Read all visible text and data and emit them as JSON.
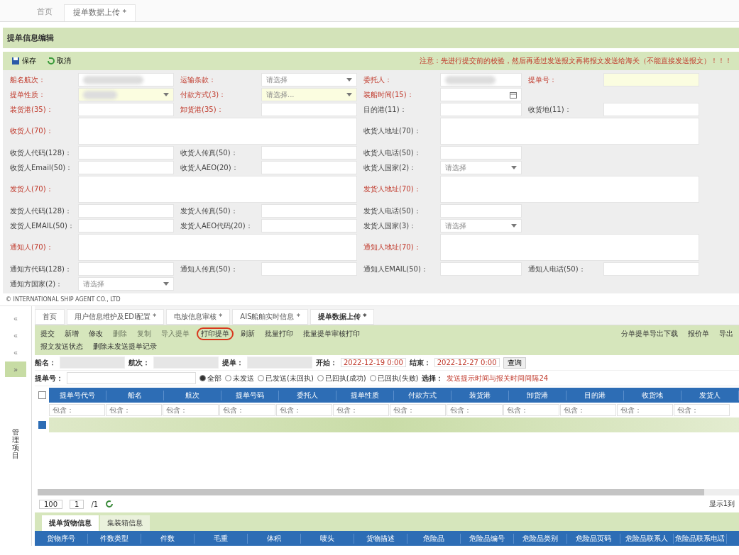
{
  "top_tabs": [
    {
      "label": "首页",
      "selected": false
    },
    {
      "label": "提单数据上传 *",
      "selected": true
    }
  ],
  "panel_title": "提单信息编辑",
  "toolbar": [
    {
      "label": "保存",
      "kind": "save"
    },
    {
      "label": "取消",
      "kind": "cancel"
    }
  ],
  "notice": "注意：先进行提交前的校验，然后再通过发送报文再将报文发送给海关（不能直接发送报文）！！！",
  "form_rows": [
    [
      {
        "label": "船名航次：",
        "required": true,
        "kind": "masked"
      },
      {
        "label": "运输条款：",
        "required": true,
        "kind": "select",
        "value": "请选择"
      },
      {
        "label": "委托人：",
        "required": true,
        "kind": "masked"
      },
      {
        "label": "提单号：",
        "required": true,
        "kind": "text",
        "highlighted": true
      }
    ],
    [
      {
        "label": "提单性质：",
        "required": true,
        "kind": "masked-select",
        "highlighted": true
      },
      {
        "label": "付款方式(3)：",
        "required": true,
        "kind": "select",
        "value": "请选择...",
        "highlighted": true
      },
      {
        "label": "装船时间(15)：",
        "required": true,
        "kind": "date"
      }
    ],
    [
      {
        "label": "装货港(35)：",
        "required": true,
        "kind": "text"
      },
      {
        "label": "卸货港(35)：",
        "required": true,
        "kind": "text"
      },
      {
        "label": "目的港(11)：",
        "required": false,
        "kind": "text"
      },
      {
        "label": "收货地(11)：",
        "required": false,
        "kind": "text"
      }
    ],
    [
      {
        "label": "收货人(70)：",
        "required": true,
        "kind": "area"
      },
      {
        "label": "收货人地址(70)：",
        "required": false,
        "kind": "area"
      }
    ],
    [
      {
        "label": "收货人代码(128)：",
        "required": false,
        "kind": "text"
      },
      {
        "label": "收货人传真(50)：",
        "required": false,
        "kind": "text"
      },
      {
        "label": "收货人电话(50)：",
        "required": false,
        "kind": "text"
      }
    ],
    [
      {
        "label": "收货人Email(50)：",
        "required": false,
        "kind": "text"
      },
      {
        "label": "收货人AEO(20)：",
        "required": false,
        "kind": "text"
      },
      {
        "label": "收货人国家(2)：",
        "required": false,
        "kind": "select",
        "value": "请选择"
      }
    ],
    [
      {
        "label": "发货人(70)：",
        "required": true,
        "kind": "area"
      },
      {
        "label": "发货人地址(70)：",
        "required": true,
        "kind": "area"
      }
    ],
    [
      {
        "label": "发货人代码(128)：",
        "required": false,
        "kind": "text"
      },
      {
        "label": "发货人传真(50)：",
        "required": false,
        "kind": "text"
      },
      {
        "label": "发货人电话(50)：",
        "required": false,
        "kind": "text"
      }
    ],
    [
      {
        "label": "发货人EMAIL(50)：",
        "required": false,
        "kind": "text"
      },
      {
        "label": "发货人AEO代码(20)：",
        "required": false,
        "kind": "text"
      },
      {
        "label": "发货人国家(3)：",
        "required": false,
        "kind": "select",
        "value": "请选择"
      }
    ],
    [
      {
        "label": "通知人(70)：",
        "required": true,
        "kind": "area"
      },
      {
        "label": "通知人地址(70)：",
        "required": true,
        "kind": "area"
      }
    ],
    [
      {
        "label": "通知方代码(128)：",
        "required": false,
        "kind": "text"
      },
      {
        "label": "通知人传真(50)：",
        "required": false,
        "kind": "text"
      },
      {
        "label": "通知人EMAIL(50)：",
        "required": false,
        "kind": "text"
      },
      {
        "label": "通知人电话(50)：",
        "required": false,
        "kind": "text"
      }
    ],
    [
      {
        "label": "通知方国家(2)：",
        "required": false,
        "kind": "select",
        "value": "请选择"
      }
    ]
  ],
  "footer": "© INTERNATIONAL SHIP AGENT CO., LTD",
  "side_buttons": [
    "«",
    "«",
    "«",
    "»"
  ],
  "side_label": "管理项目",
  "app_tabs": [
    {
      "label": "首页",
      "selected": false
    },
    {
      "label": "用户信息维护及EDI配置 *",
      "selected": false
    },
    {
      "label": "电放信息审核 *",
      "selected": false
    },
    {
      "label": "AIS船舶实时信息 *",
      "selected": false
    },
    {
      "label": "提单数据上传 *",
      "selected": true
    }
  ],
  "actions": [
    {
      "label": "提交",
      "disabled": false,
      "highlighted": false
    },
    {
      "label": "新增",
      "disabled": false,
      "highlighted": false
    },
    {
      "label": "修改",
      "disabled": false,
      "highlighted": false
    },
    {
      "label": "删除",
      "disabled": true,
      "highlighted": false
    },
    {
      "label": "复制",
      "disabled": true,
      "highlighted": false
    },
    {
      "label": "导入提单",
      "disabled": true,
      "highlighted": false
    },
    {
      "label": "打印提单",
      "disabled": false,
      "highlighted": true
    },
    {
      "label": "刷新",
      "disabled": false,
      "highlighted": false
    },
    {
      "label": "批量打印",
      "disabled": false,
      "highlighted": false
    },
    {
      "label": "批量提单审核打印",
      "disabled": false,
      "highlighted": false
    }
  ],
  "actions_row2": [
    "报文发送状态",
    "删除未发送提单记录"
  ],
  "right_actions": [
    "分单提单导出下载",
    "报价单",
    "导出"
  ],
  "filters": {
    "vessel_label": "船名：",
    "voyage_label": "航次：",
    "bl_label": "提单：",
    "start_label": "开始：",
    "start": "2022-12-19 0:00",
    "end_label": "结束：",
    "end": "2022-12-27 0:00",
    "query": "查询",
    "bl_no_label": "提单号："
  },
  "radios": [
    {
      "label": "全部",
      "selected": true
    },
    {
      "label": "未发送",
      "selected": false
    },
    {
      "label": "已发送(未回执)",
      "selected": false
    },
    {
      "label": "已回执(成功)",
      "selected": false
    },
    {
      "label": "已回执(失败)",
      "selected": false
    }
  ],
  "select_label": "选择：",
  "hint": "发送提示时间与报关时间间隔24",
  "grid": {
    "columns": [
      {
        "label": "提单号代号",
        "filter": "包含："
      },
      {
        "label": "船名",
        "filter": "包含："
      },
      {
        "label": "航次",
        "filter": "包含："
      },
      {
        "label": "提单号码",
        "filter": "包含："
      },
      {
        "label": "委托人",
        "filter": "包含："
      },
      {
        "label": "提单性质",
        "filter": "包含："
      },
      {
        "label": "付款方式",
        "filter": "包含："
      },
      {
        "label": "装货港",
        "filter": "包含："
      },
      {
        "label": "卸货港",
        "filter": "包含："
      },
      {
        "label": "目的港",
        "filter": "包含："
      },
      {
        "label": "收货地",
        "filter": "包含："
      },
      {
        "label": "发货人",
        "filter": "包含："
      }
    ],
    "all_selected": false,
    "rows": [
      {
        "selected": true
      }
    ]
  },
  "pager": {
    "size": "100",
    "page": "1",
    "total": "/1",
    "info": "显示1到"
  },
  "detail_tabs": [
    {
      "label": "提单货物信息",
      "selected": true
    },
    {
      "label": "集装箱信息",
      "selected": false
    }
  ],
  "detail_columns": [
    "货物序号",
    "件数类型",
    "件数",
    "毛重",
    "体积",
    "唛头",
    "货物描述",
    "危险品",
    "危险品编号",
    "危险品类别",
    "危险品页码",
    "危险品联系人",
    "危险品联系电话"
  ]
}
